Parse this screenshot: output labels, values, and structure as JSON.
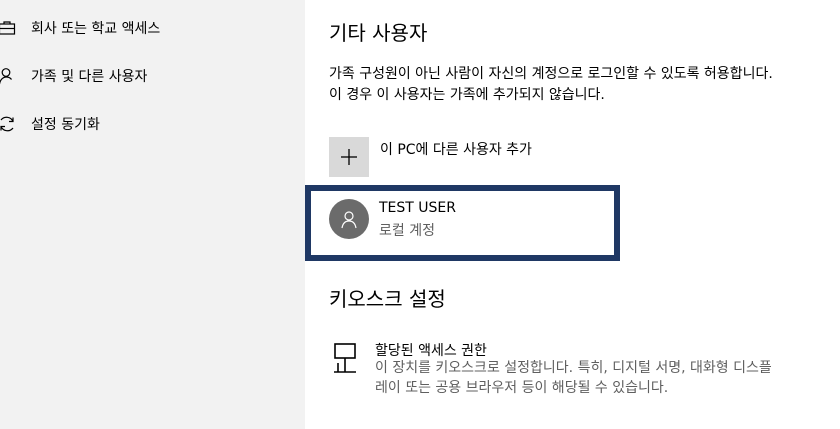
{
  "sidebar": {
    "items": [
      {
        "label": "회사 또는 학교 액세스",
        "icon": "briefcase-icon"
      },
      {
        "label": "가족 및 다른 사용자",
        "icon": "person-icon"
      },
      {
        "label": "설정 동기화",
        "icon": "sync-icon"
      }
    ]
  },
  "other_users": {
    "title": "기타 사용자",
    "description": "가족 구성원이 아닌 사람이 자신의 계정으로 로그인할 수 있도록 허용합니다. 이 경우 이 사용자는 가족에 추가되지 않습니다.",
    "add_label": "이 PC에 다른 사용자 추가",
    "user": {
      "name": "TEST USER",
      "type": "로컬 계정"
    }
  },
  "kiosk": {
    "title": "키오스크 설정",
    "item_title": "할당된 액세스 권한",
    "item_desc": "이 장치를 키오스크로 설정합니다. 특히, 디지털 서명, 대화형 디스플레이 또는 공용 브라우저 등이 해당될 수 있습니다."
  },
  "colors": {
    "highlight_border": "#1f3864",
    "sidebar_bg": "#f2f2f2",
    "add_tile_bg": "#d9d9d9",
    "avatar_bg": "#6b6b6b"
  }
}
